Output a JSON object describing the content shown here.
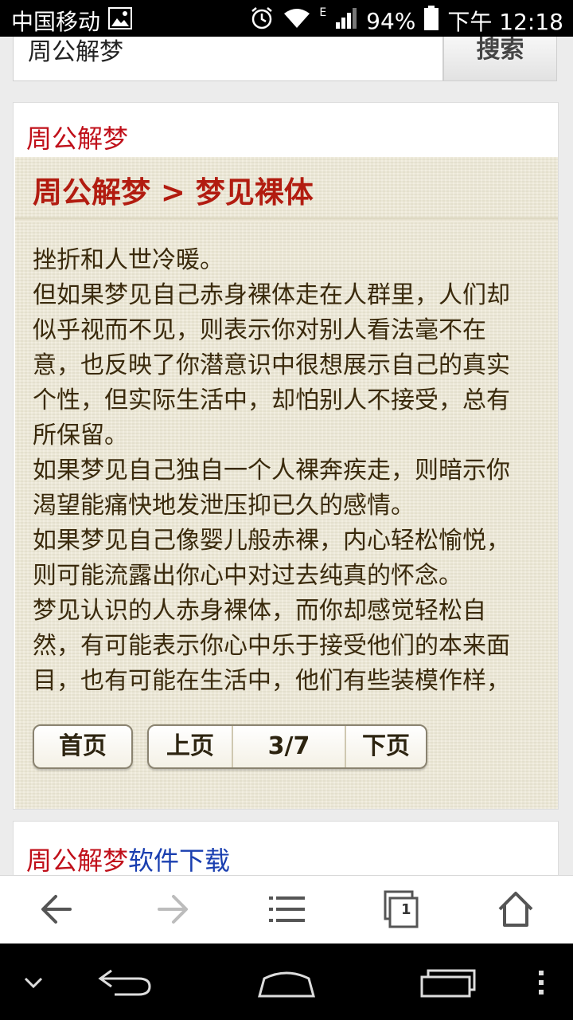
{
  "status_bar": {
    "carrier": "中国移动",
    "network_type": "E",
    "battery": "94%",
    "time": "下午 12:18"
  },
  "search": {
    "value": "周公解梦",
    "button_label": "搜索"
  },
  "main_card": {
    "header": "周公解梦",
    "breadcrumb": "周公解梦 > 梦见裸体",
    "lines": [
      "挫折和人世冷暖。",
      "但如果梦见自己赤身裸体走在人群里，人们却",
      "似乎视而不见，则表示你对别人看法毫不在",
      "意，也反映了你潜意识中很想展示自己的真实",
      "个性，但实际生活中，却怕别人不接受，总有",
      "所保留。",
      "如果梦见自己独自一个人裸奔疾走，则暗示你",
      "渴望能痛快地发泄压抑已久的感情。",
      "如果梦见自己像婴儿般赤裸，内心轻松愉悦，",
      "则可能流露出你心中对过去纯真的怀念。",
      "梦见认识的人赤身裸体，而你却感觉轻松自",
      "然，有可能表示你心中乐于接受他们的本来面",
      "目，也有可能在生活中，他们有些装模作样，"
    ],
    "pager": {
      "first": "首页",
      "prev": "上页",
      "current": "3/7",
      "next": "下页"
    }
  },
  "download_card": {
    "title_red": "周公解梦",
    "title_blue": "软件下载"
  },
  "browser_toolbar": {
    "tab_count": "1",
    "icons": [
      "back-arrow-icon",
      "forward-arrow-icon",
      "menu-list-icon",
      "tabs-icon",
      "home-icon"
    ]
  },
  "nav_bar": {
    "icons": [
      "chevron-down-icon",
      "back-icon",
      "home-icon",
      "recents-icon",
      "overflow-menu-icon"
    ]
  },
  "colors": {
    "accent_red": "#c0101a",
    "link_blue": "#1a3fb0",
    "paper": "#ede8d5"
  }
}
